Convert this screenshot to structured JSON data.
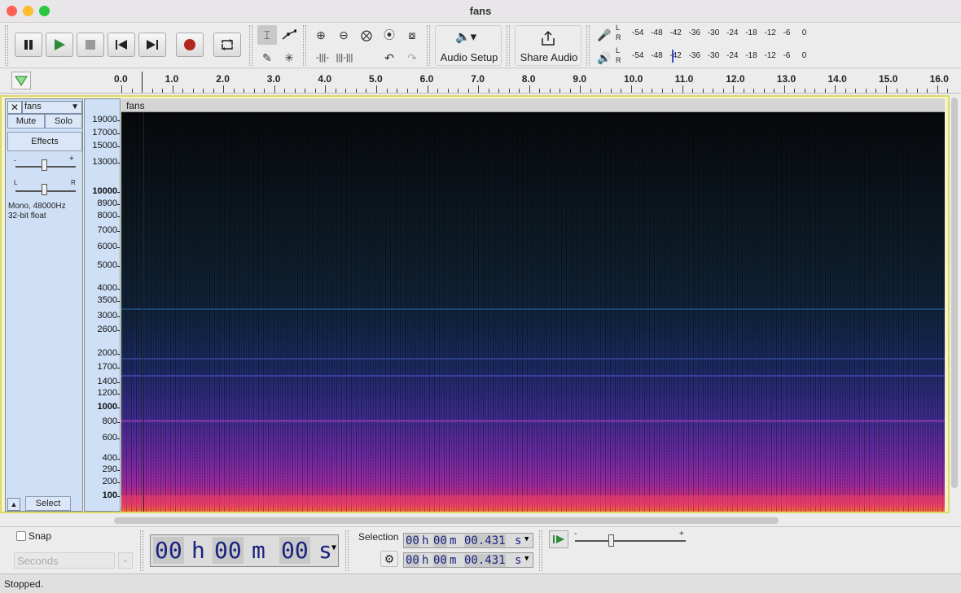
{
  "window": {
    "title": "fans"
  },
  "colors": {
    "close": "#ff5f57",
    "minimize": "#febc2e",
    "maximize": "#28c840",
    "spectrogram_bg": "#0c0e12",
    "track_selected": "#f5f3c8",
    "digits": "#1a237e"
  },
  "transport": {
    "pause_icon": "pause-icon",
    "play_icon": "play-icon",
    "stop_icon": "stop-icon",
    "skip_start_icon": "skip-to-start-icon",
    "skip_end_icon": "skip-to-end-icon",
    "record_icon": "record-icon",
    "loop_icon": "loop-icon"
  },
  "tools": {
    "audio_setup_label": "Audio Setup",
    "share_audio_label": "Share Audio"
  },
  "meters": {
    "record": {
      "L": "L",
      "R": "R",
      "ticks": [
        "-54",
        "-48",
        "-42",
        "-36",
        "-30",
        "-24",
        "-18",
        "-12",
        "-6",
        "0"
      ]
    },
    "play": {
      "L": "L",
      "R": "R",
      "ticks": [
        "-54",
        "-48",
        "-42",
        "-36",
        "-30",
        "-24",
        "-18",
        "-12",
        "-6",
        "0"
      ]
    }
  },
  "ruler": {
    "ticks": [
      "0.0",
      "1.0",
      "2.0",
      "3.0",
      "4.0",
      "5.0",
      "6.0",
      "7.0",
      "8.0",
      "9.0",
      "10.0",
      "11.0",
      "12.0",
      "13.0",
      "14.0",
      "15.0",
      "16.0"
    ]
  },
  "track": {
    "name": "fans",
    "clip_name": "fans",
    "mute": "Mute",
    "solo": "Solo",
    "effects": "Effects",
    "gain_minus": "-",
    "gain_plus": "+",
    "pan_left": "L",
    "pan_right": "R",
    "info_line1": "Mono, 48000Hz",
    "info_line2": "32-bit float",
    "select": "Select",
    "freq_labels": [
      "19000",
      "17000",
      "15000",
      "13000",
      "10000",
      "8900",
      "8000",
      "7000",
      "6000",
      "5000",
      "4000",
      "3500",
      "3000",
      "2600",
      "2000",
      "1700",
      "1400",
      "1200",
      "1000",
      "800",
      "600",
      "400",
      "290",
      "200",
      "100"
    ]
  },
  "bottom": {
    "snap_label": "Snap",
    "snap_unit": "Seconds",
    "time": {
      "h": "00",
      "h_unit": "h",
      "m": "00",
      "m_unit": "m",
      "s": "00",
      "s_unit": "s"
    },
    "selection_label": "Selection",
    "sel_start": {
      "h": "00",
      "m": "00",
      "s": "00.431",
      "hu": "h",
      "mu": "m",
      "su": "s"
    },
    "sel_end": {
      "h": "00",
      "m": "00",
      "s": "00.431",
      "hu": "h",
      "mu": "m",
      "su": "s"
    },
    "speed_minus": "-",
    "speed_plus": "+"
  },
  "status": {
    "text": "Stopped."
  }
}
